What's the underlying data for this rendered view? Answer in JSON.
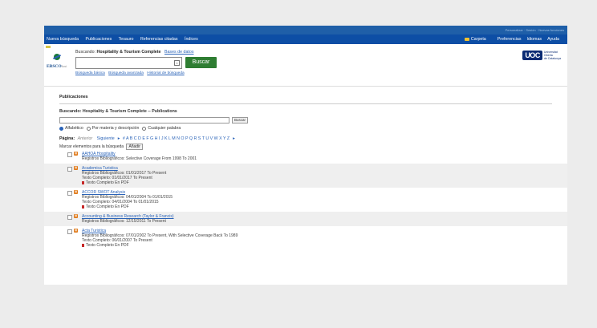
{
  "top_links": [
    "Personalizar",
    "Sesión",
    "Nuevas funciones"
  ],
  "nav": {
    "left": [
      "Nueva búsqueda",
      "Publicaciones",
      "Tesauro",
      "Referencias citadas",
      "Índices"
    ],
    "right": [
      "Carpeta",
      "Preferencias",
      "Idiomas",
      "Ayuda"
    ]
  },
  "logo": {
    "brand": "EBSCO",
    "host": "host"
  },
  "search": {
    "label_prefix": "Buscando:",
    "label_db": "Hospitality & Tourism Complete",
    "db_link": "Bases de datos",
    "button": "Buscar",
    "links": [
      "Búsqueda básica",
      "Búsqueda avanzada",
      "Historial de búsqueda"
    ]
  },
  "uoc": {
    "mark": "UOC",
    "name": [
      "Universitat",
      "Oberta",
      "de Catalunya"
    ]
  },
  "content": {
    "section_title": "Publicaciones",
    "buscando": "Buscando: Hospitality & Tourism Complete -- Publications",
    "buscar_btn": "Buscar",
    "radios": [
      "Alfabético",
      "Por materia y descripción",
      "Cualquier palabra"
    ],
    "pagina_label": "Página:",
    "anterior": "Anterior",
    "siguiente": "Siguiente",
    "letters": "# A B C D E F G H I J K L M N O P Q R S T U V W X Y Z",
    "marcar": "Marcar elementos para la búsqueda",
    "anadir": "Añadir"
  },
  "items": [
    {
      "name": "AAHOA Hospitality",
      "lines": [
        "Registros Bibliográficos: Selective Coverage From 1998 To 2001"
      ],
      "pdf": ""
    },
    {
      "name": "Academica Turistica",
      "lines": [
        "Registros Bibliográficos: 01/01/2017 To Present",
        "Texto Completo: 01/01/2017 To Present"
      ],
      "pdf": "Texto Completo En PDF"
    },
    {
      "name": "ACCOR SWOT Analysis",
      "lines": [
        "Registros Bibliográficos: 04/01/2004 To 01/01/2015",
        "Texto Completo: 04/01/2004 To 01/01/2015"
      ],
      "pdf": "Texto Completo En PDF"
    },
    {
      "name": "Accounting & Business Research (Taylor & Francis)",
      "lines": [
        "Registros Bibliográficos: 12/15/2011 To Present"
      ],
      "pdf": ""
    },
    {
      "name": "Acta Turistica",
      "lines": [
        "Registros Bibliográficos: 07/01/2002 To Present, With Selective Coverage Back To 1989",
        "Texto Completo: 06/01/2007 To Present"
      ],
      "pdf": "Texto Completo En PDF"
    }
  ]
}
